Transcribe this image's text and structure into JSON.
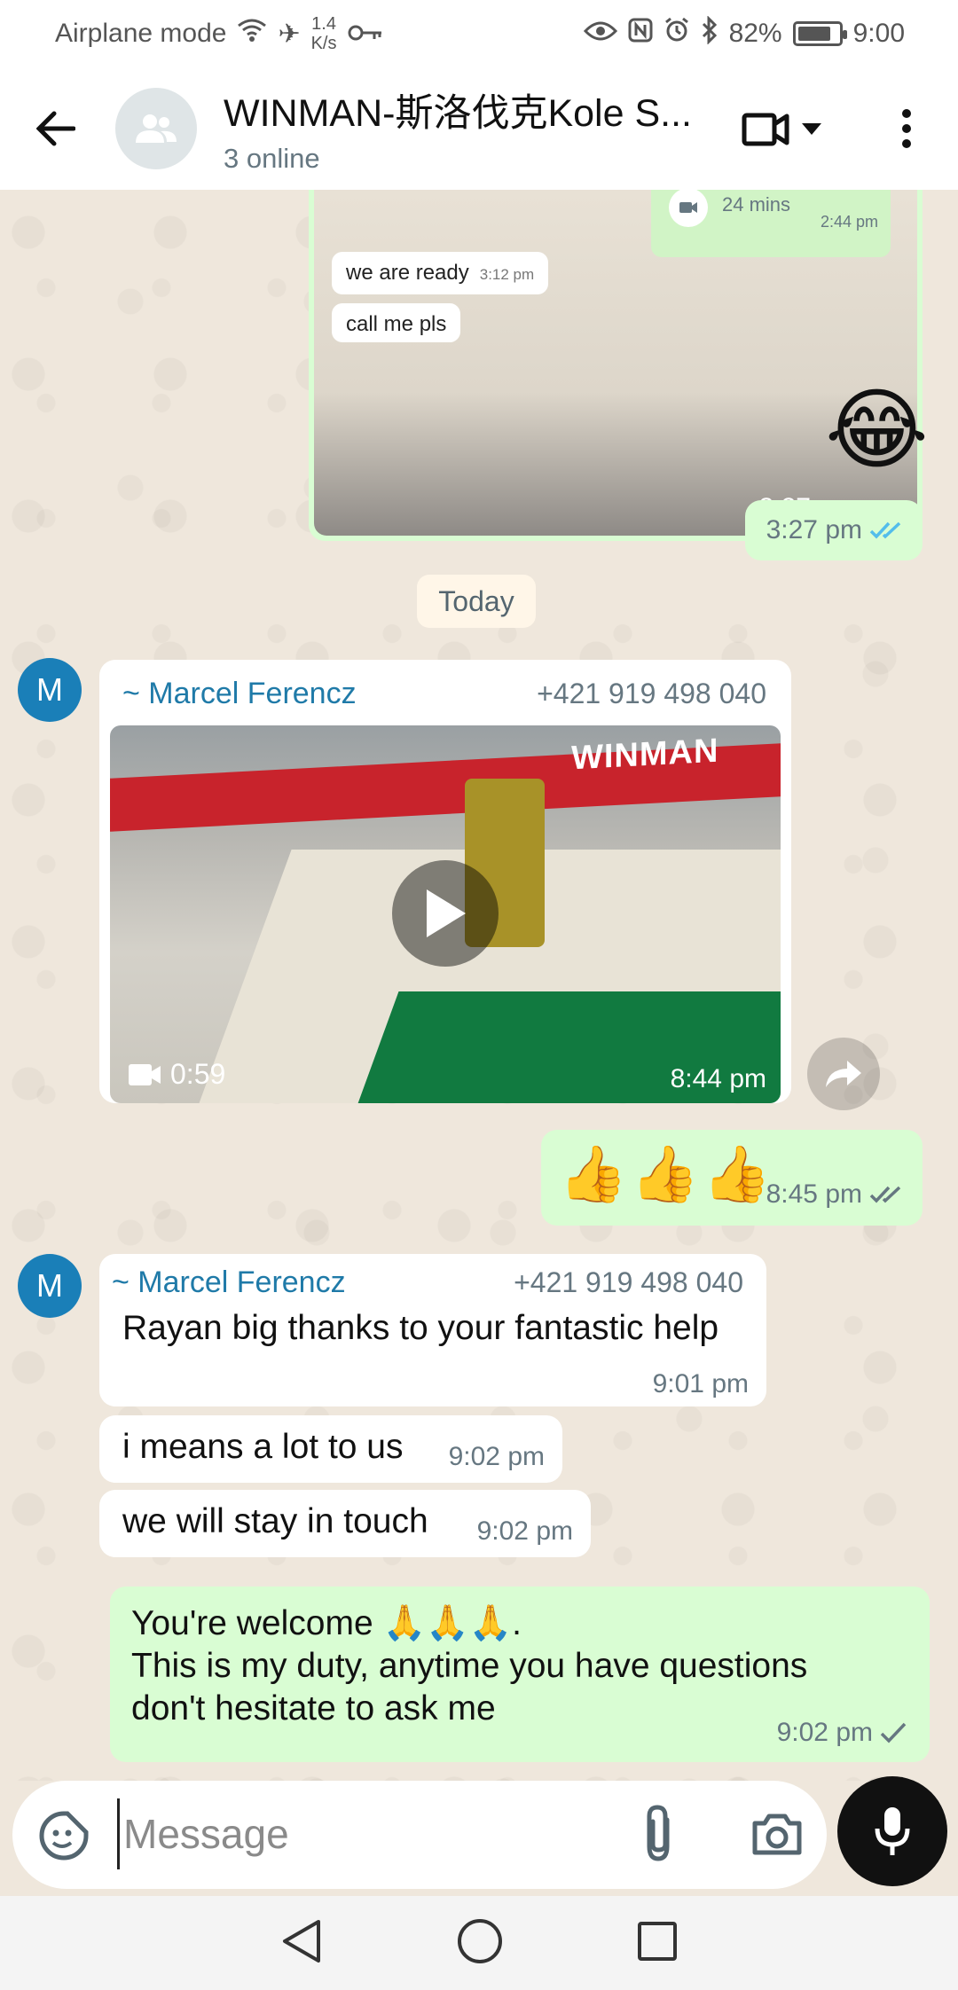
{
  "status_bar": {
    "airplane_label": "Airplane mode",
    "net_speed_value": "1.4",
    "net_speed_unit": "K/s",
    "battery": "82%",
    "battery_level": 0.82,
    "time": "9:00"
  },
  "header": {
    "title": "WINMAN-斯洛伐克Kole S...",
    "subtitle": "3 online"
  },
  "forwarded_screenshot": {
    "call_label": "24 mins",
    "call_time": "2:44 pm",
    "msg1": "we are ready",
    "msg1_time": "3:12 pm",
    "msg2": "call me pls",
    "time": "3:27 pm"
  },
  "emoji_message": {
    "emoji": "😂",
    "time": "3:27 pm"
  },
  "date_chip": "Today",
  "video_message": {
    "sender_initial": "M",
    "sender_name": "~ Marcel Ferencz",
    "sender_phone": "+421 919 498 040",
    "brand_text": "WINMAN",
    "duration": "0:59",
    "time": "8:44 pm"
  },
  "thumbs_message": {
    "emoji": "👍👍👍",
    "time": "8:45 pm"
  },
  "text_message_1": {
    "sender_initial": "M",
    "sender_name": "~ Marcel Ferencz",
    "sender_phone": "+421 919 498 040",
    "text": "Rayan big thanks to your fantastic help",
    "time": "9:01 pm"
  },
  "text_message_2": {
    "text": "i means a lot to us",
    "time": "9:02 pm"
  },
  "text_message_3": {
    "text": "we will stay in touch",
    "time": "9:02 pm"
  },
  "outgoing_reply": {
    "line1": "You're welcome 🙏🙏🙏.",
    "line2": "This is my duty, anytime you have questions",
    "line3": "don't hesitate to ask me",
    "time": "9:02 pm"
  },
  "input": {
    "placeholder": "Message"
  },
  "colors": {
    "outgoing_bubble": "#d9fdd3",
    "incoming_bubble": "#ffffff",
    "chat_background": "#efe7dc",
    "read_tick": "#53bdeb",
    "sender_name": "#1f7aa8"
  }
}
